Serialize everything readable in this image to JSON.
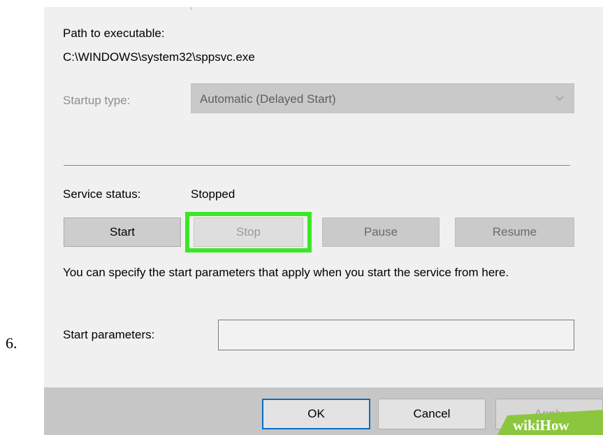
{
  "step": {
    "number": "6."
  },
  "dialog": {
    "path_label": "Path to executable:",
    "path_value": "C:\\WINDOWS\\system32\\sppsvc.exe",
    "startup_type_label": "Startup type:",
    "startup_type_value": "Automatic (Delayed Start)",
    "service_status_label": "Service status:",
    "service_status_value": "Stopped",
    "buttons": {
      "start": "Start",
      "stop": "Stop",
      "pause": "Pause",
      "resume": "Resume"
    },
    "description": "You can specify the start parameters that apply when you start the service from here.",
    "start_parameters_label": "Start parameters:",
    "start_parameters_value": "",
    "footer": {
      "ok": "OK",
      "cancel": "Cancel",
      "apply": "Apply"
    }
  },
  "watermark": {
    "text": "wikiHow"
  },
  "colors": {
    "highlight": "#39e823",
    "ok_border": "#0b6cc4",
    "dialog_bg": "#f0f0f0"
  }
}
